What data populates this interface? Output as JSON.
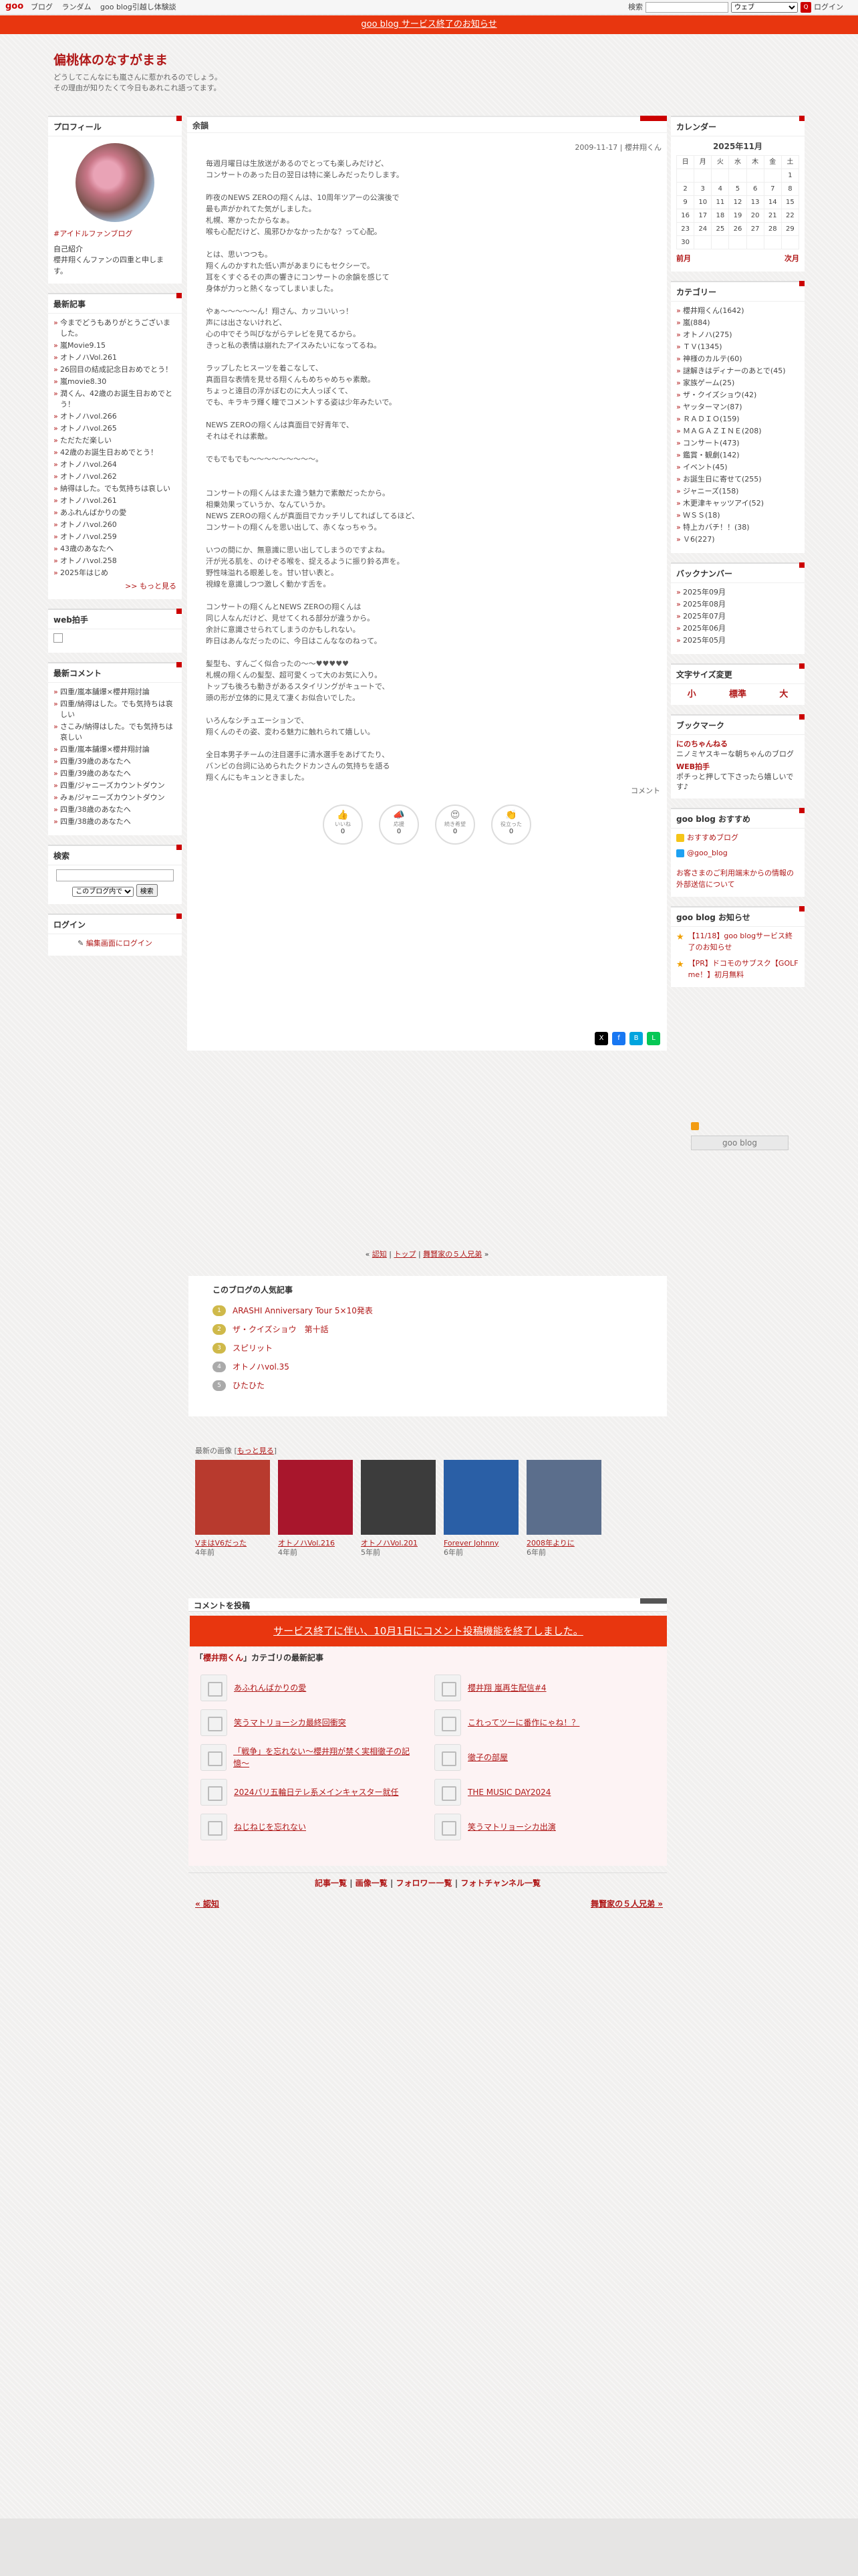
{
  "topbar": {
    "logo": "goo",
    "nav": [
      "ブログ",
      "ランダム",
      "goo blog引越し体験談"
    ],
    "search_label": "検索",
    "search_select": "ウェブ",
    "search_btn": "Q",
    "login": "ログイン"
  },
  "notice": "goo blog サービス終了のお知らせ",
  "blog": {
    "title": "偏桃体のなすがまま",
    "desc1": "どうしてこんなにも嵐さんに惹かれるのでしょう。",
    "desc2": "その理由が知りたくて今日もあれこれ語ってます。"
  },
  "profile": {
    "heading": "プロフィール",
    "tag": "#アイドルファンブログ",
    "self_title": "自己紹介",
    "self_text": "櫻井翔くんファンの四重と申します。"
  },
  "recent": {
    "heading": "最新記事",
    "items": [
      "今までどうもありがとうございました。",
      "嵐Movie9.15",
      "オトノハVol.261",
      "26回目の結成記念日おめでとう！",
      "嵐movie8.30",
      "潤くん、42歳のお誕生日おめでとう！",
      "オトノハvol.266",
      "オトノハvol.265",
      "ただただ楽しい",
      "42歳のお誕生日おめでとう！",
      "オトノハvol.264",
      "オトノハvol.262",
      "納得はした。でも気持ちは哀しい",
      "オトノハvol.261",
      "あふれんばかりの愛",
      "オトノハvol.260",
      "オトノハvol.259",
      "43歳のあなたへ",
      "オトノハvol.258",
      "2025年はじめ"
    ],
    "more": ">> もっと見る"
  },
  "webclap": {
    "heading": "web拍手"
  },
  "comments": {
    "heading": "最新コメント",
    "items": [
      "四重/嵐本舗爆×櫻井翔討論",
      "四重/納得はした。でも気持ちは哀しい",
      "さこみ/納得はした。でも気持ちは哀しい",
      "四重/嵐本舗爆×櫻井翔討論",
      "四重/39歳のあなたへ",
      "四重/39歳のあなたへ",
      "四重/ジャニーズカウントダウン",
      "みぁ/ジャニーズカウントダウン",
      "四重/38歳のあなたへ",
      "四重/38歳のあなたへ"
    ]
  },
  "search": {
    "heading": "検索",
    "select": "このブログ内で",
    "btn": "検索"
  },
  "login": {
    "heading": "ログイン",
    "link": "編集画面にログイン"
  },
  "article": {
    "cat": "余韻",
    "meta": "2009-11-17 | 櫻井翔くん",
    "body": "毎週月曜日は生放送があるのでとっても楽しみだけど、\nコンサートのあった日の翌日は特に楽しみだったりします。\n\n昨夜のNEWS ZEROの翔くんは、10周年ツアーの公演後で\n最も声がかれてた気がしました。\n札幌、寒かったからなぁ。\n喉も心配だけど、風邪ひかなかったかな？って心配。\n\nとは、思いつつも。\n翔くんのかすれた低い声があまりにもセクシーで。\n耳をくすぐるその声の響きにコンサートの余韻を感じて\n身体が力っと熱くなってしまいました。\n\nやぁ〜〜〜〜〜ん！翔さん、カッコいいっ！\n声には出さないけれど、\n心の中でそう叫びながらテレビを見てるから。\nきっと私の表情は崩れたアイスみたいになってるね。\n\nラップしたヒスーツを着こなして、\n真面目な表情を見せる翔くんもめちゃめちゃ素敵。\nちょっと遠目の浮かぼむのに大人っぽくて、\nでも、キラキラ輝く瞳でコメントする姿は少年みたいで。\n\nNEWS ZEROの翔くんは真面目で好青年で、\nそれはそれは素敵。\n\nでもでもでも〜〜〜〜〜〜〜〜〜。\n\n\nコンサートの翔くんはまた違う魅力で素敵だったから。\n相乗効果っていうか、なんていうか。\nNEWS ZEROの翔くんが真面目でカッチリしてればしてるほど、\nコンサートの翔くんを思い出して、赤くなっちゃう。\n\nいつの間にか、無意識に思い出してしまうのですよね。\n汗が光る肌を、のけぞる喉を、捉えるように振り鈴る声を。\n野性味溢れる眼差しを。甘い甘い表と。\n視線を意識しつつ激しく動かす舌を。\n\nコンサートの翔くんとNEWS ZEROの翔くんは\n同じ人なんだけど、見せてくれる部分が違うから。\n余計に意識させられてしまうのかもしれない。\n昨日はあんなだったのに、今日はこんななのねって。\n\n髪型も、すんごく似合ったの〜〜♥♥♥♥♥\n札幌の翔くんの髪型、超可愛くって大のお気に入り。\nトップも後ろも動きがあるスタイリングがキュートで、\n頭の形が立体的に見えて凄くお似合いでした。\n\nいろんなシチュエーションで、\n翔くんのその姿、変わる魅力に触れられて嬉しい。\n\n全日本男子チームの注目選手に清水選手をあげてたり、\nバンビの台詞に込められたクドカンさんの気持ちを語る\n翔くんにもキュンときました。",
    "footer": "コメント",
    "reactions": [
      {
        "label": "いいね",
        "icon": "👍",
        "count": "0"
      },
      {
        "label": "応援",
        "icon": "📣",
        "count": "0"
      },
      {
        "label": "続き希望",
        "icon": "😍",
        "count": "0"
      },
      {
        "label": "役立った",
        "icon": "👏",
        "count": "0"
      }
    ]
  },
  "calendar": {
    "heading": "カレンダー",
    "month": "2025年11月",
    "days": [
      "日",
      "月",
      "火",
      "水",
      "木",
      "金",
      "土"
    ],
    "weeks": [
      [
        "",
        "",
        "",
        "",
        "",
        "",
        "1"
      ],
      [
        "2",
        "3",
        "4",
        "5",
        "6",
        "7",
        "8"
      ],
      [
        "9",
        "10",
        "11",
        "12",
        "13",
        "14",
        "15"
      ],
      [
        "16",
        "17",
        "18",
        "19",
        "20",
        "21",
        "22"
      ],
      [
        "23",
        "24",
        "25",
        "26",
        "27",
        "28",
        "29"
      ],
      [
        "30",
        "",
        "",
        "",
        "",
        "",
        ""
      ]
    ],
    "prev": "前月",
    "next": "次月"
  },
  "categories": {
    "heading": "カテゴリー",
    "items": [
      "櫻井翔くん(1642)",
      "嵐(884)",
      "オトノハ(275)",
      "ＴＶ(1345)",
      "神様のカルテ(60)",
      "謎解きはディナーのあとで(45)",
      "家族ゲーム(25)",
      "ザ・クイズショウ(42)",
      "ヤッターマン(87)",
      "ＲＡＤＩＯ(159)",
      "ＭＡＧＡＺＩＮＥ(208)",
      "コンサート(473)",
      "鑑賞・観劇(142)",
      "イベント(45)",
      "お誕生日に寄せて(255)",
      "ジャニーズ(158)",
      "木更津キャッツアイ(52)",
      "ＷＳＳ(18)",
      "特上カバチ！！(38)",
      "Ｖ6(227)"
    ]
  },
  "backnumber": {
    "heading": "バックナンバー",
    "items": [
      "2025年09月",
      "2025年08月",
      "2025年07月",
      "2025年06月",
      "2025年05月"
    ]
  },
  "textsize": {
    "heading": "文字サイズ変更",
    "small": "小",
    "mid": "標準",
    "large": "大"
  },
  "bookmark": {
    "heading": "ブックマーク",
    "name1": "にのちゃんねる",
    "desc1": "ニノミヤスキーな朝ちゃんのブログ",
    "name2": "WEB拍手",
    "desc2": "ポチっと押して下さったら嬉しいです♪"
  },
  "goo_osusume": {
    "heading": "goo blog おすすめ",
    "items": [
      "おすすめブログ",
      "@goo_blog"
    ],
    "notice": "お客さまのご利用端末からの情報の外部送信について"
  },
  "goo_info": {
    "heading": "goo blog お知らせ",
    "items": [
      "【11/18】goo blogサービス終了のお知らせ",
      "【PR】ドコモのサブスク【GOLF me！】初月無料"
    ]
  },
  "goo_logo": "goo blog",
  "pager": {
    "prev": "認知",
    "top": "トップ",
    "next": "舞賢家の５人兄弟"
  },
  "popular": {
    "heading": "このブログの人気記事",
    "items": [
      {
        "rank": "1",
        "title": "ARASHI Anniversary Tour 5×10発表"
      },
      {
        "rank": "2",
        "title": "ザ・クイズショウ　第十話"
      },
      {
        "rank": "3",
        "title": "スピリット"
      },
      {
        "rank": "4",
        "title": "オトノハvol.35"
      },
      {
        "rank": "5",
        "title": "ひたひた"
      }
    ]
  },
  "latest_images": {
    "label": "最新の画像",
    "more": "もっと見る",
    "items": [
      {
        "title": "VまはV6だった",
        "ago": "4年前"
      },
      {
        "title": "オトノハVol.216",
        "ago": "4年前"
      },
      {
        "title": "オトノハVol.201",
        "ago": "5年前"
      },
      {
        "title": "Forever Johnny",
        "ago": "6年前"
      },
      {
        "title": "2008年よりに",
        "ago": "6年前"
      }
    ]
  },
  "comment_post": {
    "heading": "コメントを投稿",
    "banner": "サービス終了に伴い、10月1日にコメント投稿機能を終了しました。"
  },
  "cat_latest": {
    "prefix": "「",
    "cat": "櫻井翔くん",
    "suffix": "」カテゴリの最新記事",
    "items": [
      "あふれんばかりの愛",
      "櫻井翔 嵐再生配信#4",
      "笑うマトリョーシカ最終回衝突",
      "これってツーに番作にゃね！？",
      "「戦争」を忘れない〜櫻井翔が禁く実相徹子の記憶〜",
      "徹子の部屋",
      "2024パリ五輪日テレ系メインキャスター就任",
      "THE MUSIC DAY2024",
      "ねじねじを忘れない",
      "笑うマトリョーシカ出演"
    ]
  },
  "bottom_links": [
    "記事一覧",
    "画像一覧",
    "フォロワー一覧",
    "フォトチャンネル一覧"
  ],
  "bottom_nav": {
    "prev": "« 認知",
    "next": "舞賢家の５人兄弟 »"
  }
}
